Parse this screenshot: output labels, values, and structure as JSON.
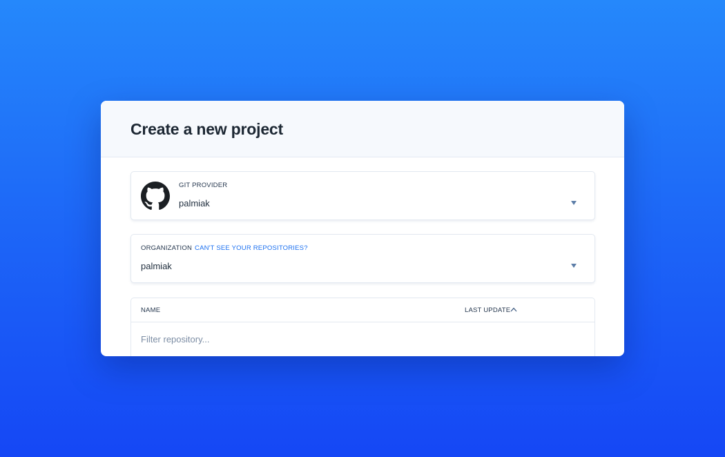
{
  "modal": {
    "title": "Create a new project"
  },
  "git_provider": {
    "label": "GIT PROVIDER",
    "value": "palmiak",
    "icon": "github-icon"
  },
  "organization": {
    "label": "ORGANIZATION",
    "help_link": "CAN'T SEE YOUR REPOSITORIES?",
    "value": "palmiak"
  },
  "repositories": {
    "columns": {
      "name": "NAME",
      "last_update": "LAST UPDATE"
    },
    "sort_icon": "chevron-up-icon",
    "filter_placeholder": "Filter repository..."
  },
  "colors": {
    "background_top": "#2588fb",
    "background_bottom": "#1547f5",
    "link": "#1a6ff0",
    "caret": "#5d7ea8"
  }
}
